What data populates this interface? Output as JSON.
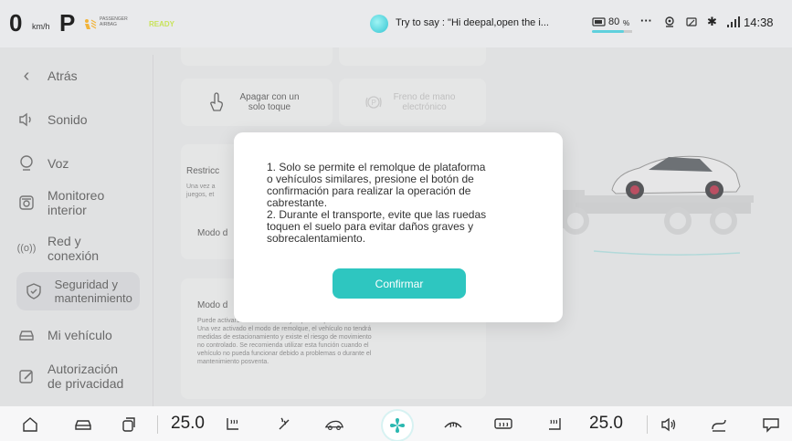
{
  "status_bar": {
    "speed": "0",
    "speed_unit": "km/h",
    "gear": "P",
    "airbag_text": "PASSENGER AIRBAG",
    "ready": "READY",
    "assistant_hint": "Try to say : \"Hi deepal,open the i...",
    "battery_percent": "80",
    "battery_unit": "%",
    "battery_level": 0.8,
    "more": "···",
    "time": "14:38"
  },
  "sidebar": {
    "items": [
      {
        "label": "Atrás",
        "icon": "back-icon"
      },
      {
        "label": "Sonido",
        "icon": "sound-icon"
      },
      {
        "label": "Voz",
        "icon": "voice-icon"
      },
      {
        "label": "Monitoreo interior",
        "icon": "camera-icon"
      },
      {
        "label": "Red y conexión",
        "icon": "network-icon"
      },
      {
        "label": "Seguridad y mantenimiento",
        "icon": "shield-icon"
      },
      {
        "label": "Mi vehículo",
        "icon": "car-icon"
      },
      {
        "label": "Autorización de privacidad",
        "icon": "privacy-icon"
      }
    ]
  },
  "main": {
    "power_off": "Apagar con un solo toque",
    "parking_brake": "Freno de mano electrónico",
    "restriction_title": "Restricc",
    "restriction_desc": "Una vez a\njuegos, et",
    "mode_d_label": "Modo d",
    "tow_title": "Modo d",
    "tow_desc": "Puede activarse en la marcha P y al pisar el pedal de freno.\nUna vez activado el modo de remolque, el vehículo no tendrá\nmedidas de estacionamiento y existe el riesgo de movimiento\nno controlado. Se recomienda utilizar esta función cuando el\nvehículo no pueda funcionar debido a problemas o durante el\nmantenimiento posventa."
  },
  "modal": {
    "text": "1. Solo se permite el remolque de plataforma\no vehículos similares, presione el botón de\nconfirmación para realizar la operación de\ncabrestante.\n2. Durante el transporte, evite que las ruedas\ntoquen el suelo para evitar daños graves y\nsobrecalentamiento.",
    "confirm_label": "Confirmar"
  },
  "bottom_bar": {
    "temp_left": "25.0",
    "temp_right": "25.0"
  }
}
